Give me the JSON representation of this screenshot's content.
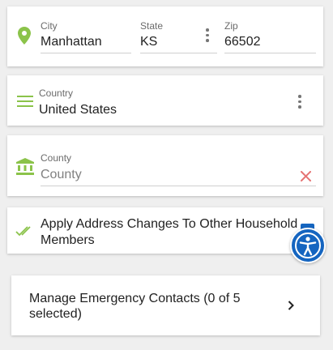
{
  "address": {
    "city": {
      "label": "City",
      "value": "Manhattan"
    },
    "state": {
      "label": "State",
      "value": "KS"
    },
    "zip": {
      "label": "Zip",
      "value": "66502"
    }
  },
  "country": {
    "label": "Country",
    "value": "United States"
  },
  "county": {
    "label": "County",
    "placeholder": "County"
  },
  "apply_changes": {
    "label": "Apply Address Changes To Other Household Members"
  },
  "emergency": {
    "label": "Manage Emergency Contacts (0 of 5 selected)"
  },
  "colors": {
    "accent_green": "#8bc34a",
    "clear_red": "#e57373",
    "accessibility_blue": "#1565c0"
  },
  "icons": [
    "location-pin-icon",
    "menu-lines-icon",
    "bank-icon",
    "double-check-icon",
    "clear-icon",
    "kebab-icon",
    "chevron-right-icon",
    "accessibility-icon"
  ]
}
